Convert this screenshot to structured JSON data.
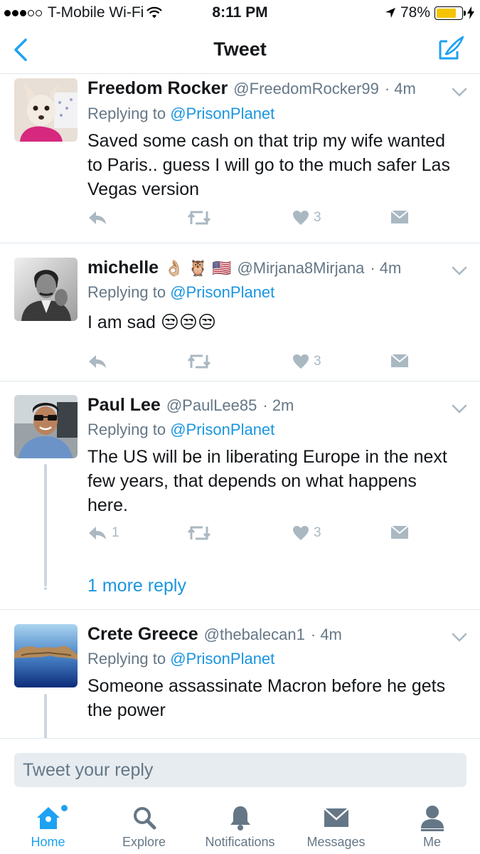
{
  "status_bar": {
    "carrier": "T-Mobile Wi-Fi",
    "time": "8:11 PM",
    "battery": "78%",
    "battery_level": 0.78
  },
  "nav": {
    "title": "Tweet",
    "back_icon": "chevron-left-icon",
    "compose_icon": "compose-icon"
  },
  "tweets": [
    {
      "name": "Freedom Rocker",
      "handle": "@FreedomRocker99",
      "time": "· 4m",
      "replying_prefix": "Replying to",
      "replying_to": "@PrisonPlanet",
      "text": "Saved some cash on that trip my wife wanted to Paris.. guess I will go to the much safer Las Vegas version",
      "likes": "3"
    },
    {
      "name": "michelle",
      "name_emoji": "👌🏼 🦉 🇺🇸",
      "handle": "@Mirjana8Mirjana",
      "time": "· 4m",
      "replying_prefix": "Replying to",
      "replying_to": "@PrisonPlanet",
      "text": "I am sad 😒😒😒",
      "likes": "3"
    },
    {
      "name": "Paul Lee",
      "handle": "@PaulLee85",
      "time": "· 2m",
      "replying_prefix": "Replying to",
      "replying_to": "@PrisonPlanet",
      "text": "The US will be in liberating Europe in the next few years, that depends on what happens here.",
      "replies": "1",
      "likes": "3",
      "more_replies": "1 more reply"
    },
    {
      "name": "Crete Greece",
      "handle": "@thebalecan1",
      "time": "· 4m",
      "replying_prefix": "Replying to",
      "replying_to": "@PrisonPlanet",
      "text": "Someone assassinate Macron before he gets the power"
    }
  ],
  "reply_box": {
    "placeholder": "Tweet your reply"
  },
  "tabs": [
    {
      "label": "Home",
      "icon": "home-icon",
      "active": true
    },
    {
      "label": "Explore",
      "icon": "search-icon",
      "active": false
    },
    {
      "label": "Notifications",
      "icon": "bell-icon",
      "active": false
    },
    {
      "label": "Messages",
      "icon": "envelope-icon",
      "active": false
    },
    {
      "label": "Me",
      "icon": "person-icon",
      "active": false
    }
  ],
  "colors": {
    "accent": "#1da1f2",
    "link": "#1b95e0",
    "muted": "#657786",
    "action_gray": "#aab8c2"
  }
}
